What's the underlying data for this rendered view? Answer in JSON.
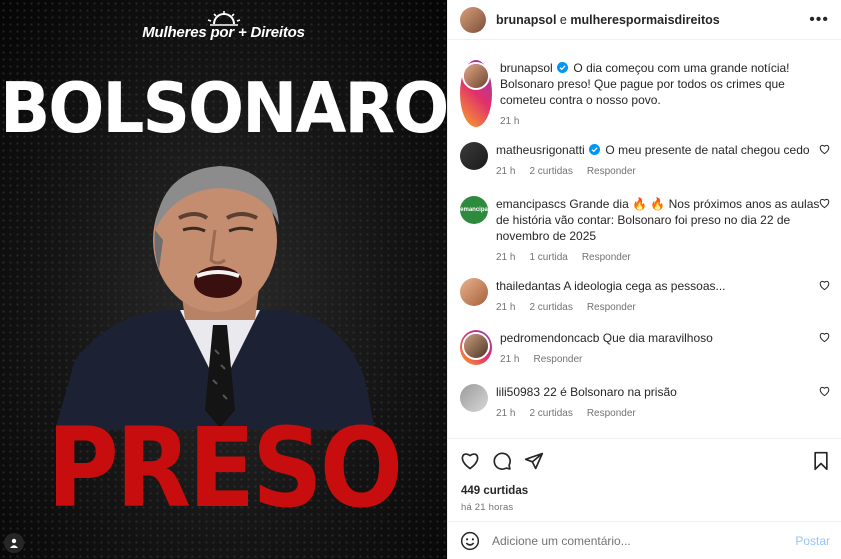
{
  "media": {
    "brand_text": "Mulheres por + Direitos",
    "headline": "BOLSONARO",
    "footer_word": "PRESO"
  },
  "header": {
    "account_a": "brunapsol",
    "connector": "e",
    "account_b": "mulherespormaisdireitos"
  },
  "caption": {
    "user": "brunapsol",
    "verified": true,
    "text": "O dia começou com uma grande notícia! Bolsonaro preso! Que pague por todos os crimes que cometeu contra o nosso povo.",
    "time": "21 h"
  },
  "comments": [
    {
      "user": "matheusrigonatti",
      "verified": true,
      "text": "O meu presente de natal chegou cedo",
      "time": "21 h",
      "likes": "2 curtidas",
      "reply": "Responder"
    },
    {
      "user": "emancipascs",
      "verified": false,
      "text": "Grande dia 🔥 🔥 Nos próximos anos as aulas de história vão contar: Bolsonaro foi preso no dia 22 de novembro de 2025",
      "time": "21 h",
      "likes": "1 curtida",
      "reply": "Responder"
    },
    {
      "user": "thailedantas",
      "verified": false,
      "text": "A ideologia cega as pessoas...",
      "time": "21 h",
      "likes": "2 curtidas",
      "reply": "Responder"
    },
    {
      "user": "pedromendoncacb",
      "verified": false,
      "text": "Que dia maravilhoso",
      "time": "21 h",
      "likes": "",
      "reply": "Responder"
    },
    {
      "user": "lili50983",
      "verified": false,
      "text": "22 é Bolsonaro na prisão",
      "time": "21 h",
      "likes": "2 curtidas",
      "reply": "Responder"
    }
  ],
  "stats": {
    "likes": "449 curtidas",
    "ago": "há 21 horas"
  },
  "add_comment": {
    "placeholder": "Adicione um comentário...",
    "post_label": "Postar"
  },
  "colors": {
    "verified": "#0095f6",
    "headline_red": "#c70d0d",
    "post_disabled": "#93c5fd"
  },
  "icons": [
    "sun-logo-icon",
    "more-icon",
    "heart-icon",
    "comment-icon",
    "share-icon",
    "bookmark-icon",
    "emoji-icon",
    "user-tag-icon"
  ]
}
